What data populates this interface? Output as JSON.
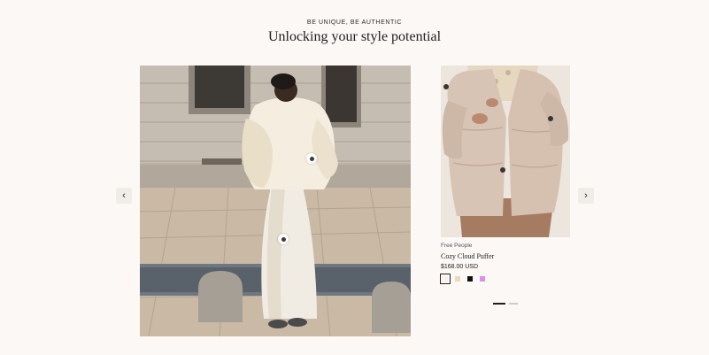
{
  "header": {
    "eyebrow": "BE UNIQUE, BE AUTHENTIC",
    "title": "Unlocking your style potential"
  },
  "navigation": {
    "prev_icon": "‹",
    "next_icon": "›"
  },
  "lookbook": {
    "hotspots": 2
  },
  "product": {
    "brand": "Free People",
    "name": "Cozy Cloud Puffer",
    "price": "$168.00 USD",
    "swatches": [
      {
        "color": "#f6f2ea",
        "selected": true
      },
      {
        "color": "#eadbb8",
        "selected": false
      },
      {
        "color": "#111111",
        "selected": false
      },
      {
        "color": "#de8ee8",
        "selected": false
      }
    ]
  },
  "pagination": {
    "total": 2,
    "active": 1
  },
  "colors": {
    "background": "#fbf8f6",
    "text": "#1f1f1f",
    "accent_dot": "#1f1f1f"
  }
}
